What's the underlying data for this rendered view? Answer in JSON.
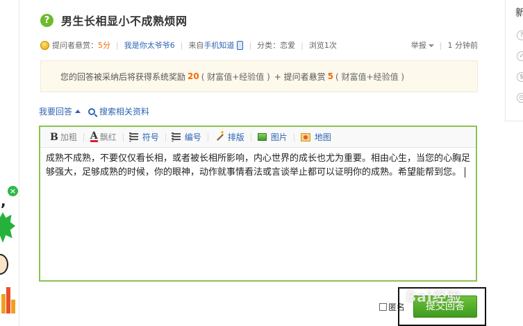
{
  "question": {
    "title": "男生长相显小不成熟烦网"
  },
  "meta": {
    "asker_reward_label": "提问者悬赏：",
    "asker_reward_value": "5分",
    "asker_name": "我是你太爷爷6",
    "source_prefix": "来自",
    "source": "手机知道",
    "category": "分类：恋爱",
    "views": "浏览1次",
    "report": "举报",
    "time": "1 分钟前"
  },
  "reward_notice": {
    "text_1": "您的回答被采纳后将获得系统奖励",
    "num_1": "20",
    "paren_1": "( 财富值+经验值 )",
    "text_2": "+ 提问者悬赏",
    "num_2": "5",
    "paren_2": "( 财富值+经验值 )"
  },
  "answer_tools": {
    "my_answer": "我要回答",
    "search_related": "搜索相关资料"
  },
  "toolbar": {
    "bold": "加粗",
    "color": "飘红",
    "bullets": "符号",
    "numbers": "编号",
    "layout": "排版",
    "image": "图片",
    "map": "地图"
  },
  "editor": {
    "content": "成熟不成熟，不要仅仅看长相，或者被长相所影响，内心世界的成长也尤为重要。相由心生，当您的心胸足够强大，足够成熟的时候，你的眼神，动作就事情看法或言谈举止都可以证明你的成熟。希望能帮到您。"
  },
  "actions": {
    "anonymous": "匿名",
    "submit": "提交回答",
    "watermark": "Bai经验"
  },
  "right_panel": {
    "label": "新"
  },
  "colors": {
    "accent_green": "#8cc152",
    "submit_green": "#4fa82a",
    "link_blue": "#2d64b3",
    "reward_orange": "#f56a00"
  }
}
